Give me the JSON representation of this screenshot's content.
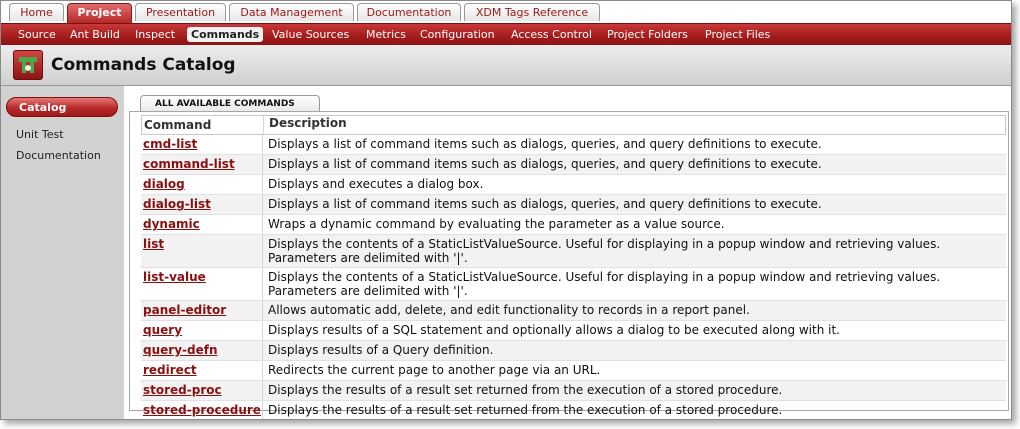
{
  "top_tabs": [
    "Home",
    "Project",
    "Presentation",
    "Data Management",
    "Documentation",
    "XDM Tags Reference"
  ],
  "sub_nav": [
    "Source",
    "Ant Build",
    "Inspect",
    "Commands",
    "Value Sources",
    "Metrics",
    "Configuration",
    "Access Control",
    "Project Folders",
    "Project Files"
  ],
  "header": {
    "title": "Commands Catalog"
  },
  "sidebar": {
    "items": [
      "Catalog",
      "Unit Test",
      "Documentation"
    ]
  },
  "panel": {
    "tab_label": "ALL AVAILABLE COMMANDS"
  },
  "table": {
    "headers": [
      "Command",
      "Description"
    ],
    "rows": [
      {
        "command": "cmd-list",
        "description": "Displays a list of command items such as dialogs, queries, and query definitions to execute."
      },
      {
        "command": "command-list",
        "description": "Displays a list of command items such as dialogs, queries, and query definitions to execute."
      },
      {
        "command": "dialog",
        "description": "Displays and executes a dialog box."
      },
      {
        "command": "dialog-list",
        "description": "Displays a list of command items such as dialogs, queries, and query definitions to execute."
      },
      {
        "command": "dynamic",
        "description": "Wraps a dynamic command by evaluating the parameter as a value source."
      },
      {
        "command": "list",
        "description": "Displays the contents of a StaticListValueSource. Useful for displaying in a popup window and retrieving values. Parameters are delimited with '|'."
      },
      {
        "command": "list-value",
        "description": "Displays the contents of a StaticListValueSource. Useful for displaying in a popup window and retrieving values. Parameters are delimited with '|'."
      },
      {
        "command": "panel-editor",
        "description": "Allows automatic add, delete, and edit functionality to records in a report panel."
      },
      {
        "command": "query",
        "description": "Displays results of a SQL statement and optionally allows a dialog to be executed along with it."
      },
      {
        "command": "query-defn",
        "description": "Displays results of a Query definition."
      },
      {
        "command": "redirect",
        "description": "Redirects the current page to another page via an URL."
      },
      {
        "command": "stored-proc",
        "description": "Displays the results of a result set returned from the execution of a stored procedure."
      },
      {
        "command": "stored-procedure",
        "description": "Displays the results of a result set returned from the execution of a stored procedure."
      }
    ]
  }
}
